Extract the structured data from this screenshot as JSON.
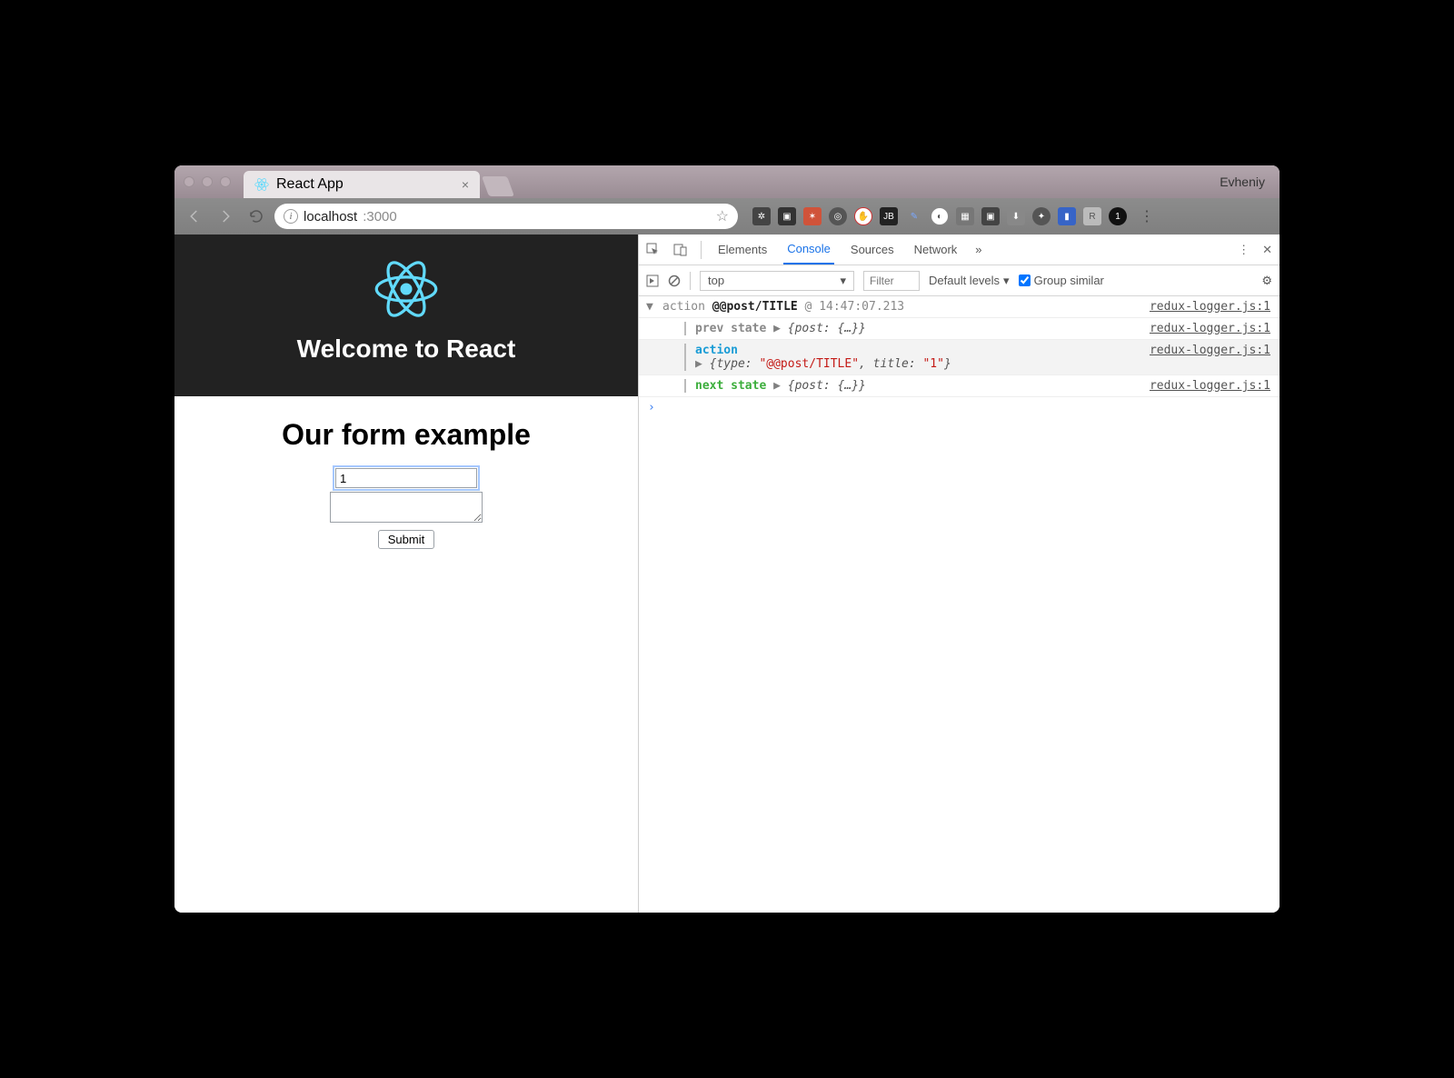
{
  "window": {
    "profile_name": "Evheniy",
    "tab_title": "React App"
  },
  "addressbar": {
    "host": "localhost",
    "port": ":3000"
  },
  "page": {
    "hero_title": "Welcome to React",
    "form_heading": "Our form example",
    "title_value": "1",
    "body_value": "",
    "submit_label": "Submit"
  },
  "devtools": {
    "tabs": {
      "elements": "Elements",
      "console": "Console",
      "sources": "Sources",
      "network": "Network"
    },
    "toolbar": {
      "context": "top",
      "filter_placeholder": "Filter",
      "levels": "Default levels",
      "group_similar": "Group similar"
    },
    "log": {
      "source": "redux-logger.js:1",
      "line1_prefix": "action",
      "line1_type": "@@post/TITLE",
      "line1_time": "@ 14:47:07.213",
      "prev_label": "prev state",
      "prev_obj": "{post: {…}}",
      "action_label": "action",
      "action_obj_pre": "{type: ",
      "action_obj_type": "\"@@post/TITLE\"",
      "action_obj_mid": ", title: ",
      "action_obj_title": "\"1\"",
      "action_obj_post": "}",
      "next_label": "next state",
      "next_obj": "{post: {…}}"
    }
  }
}
